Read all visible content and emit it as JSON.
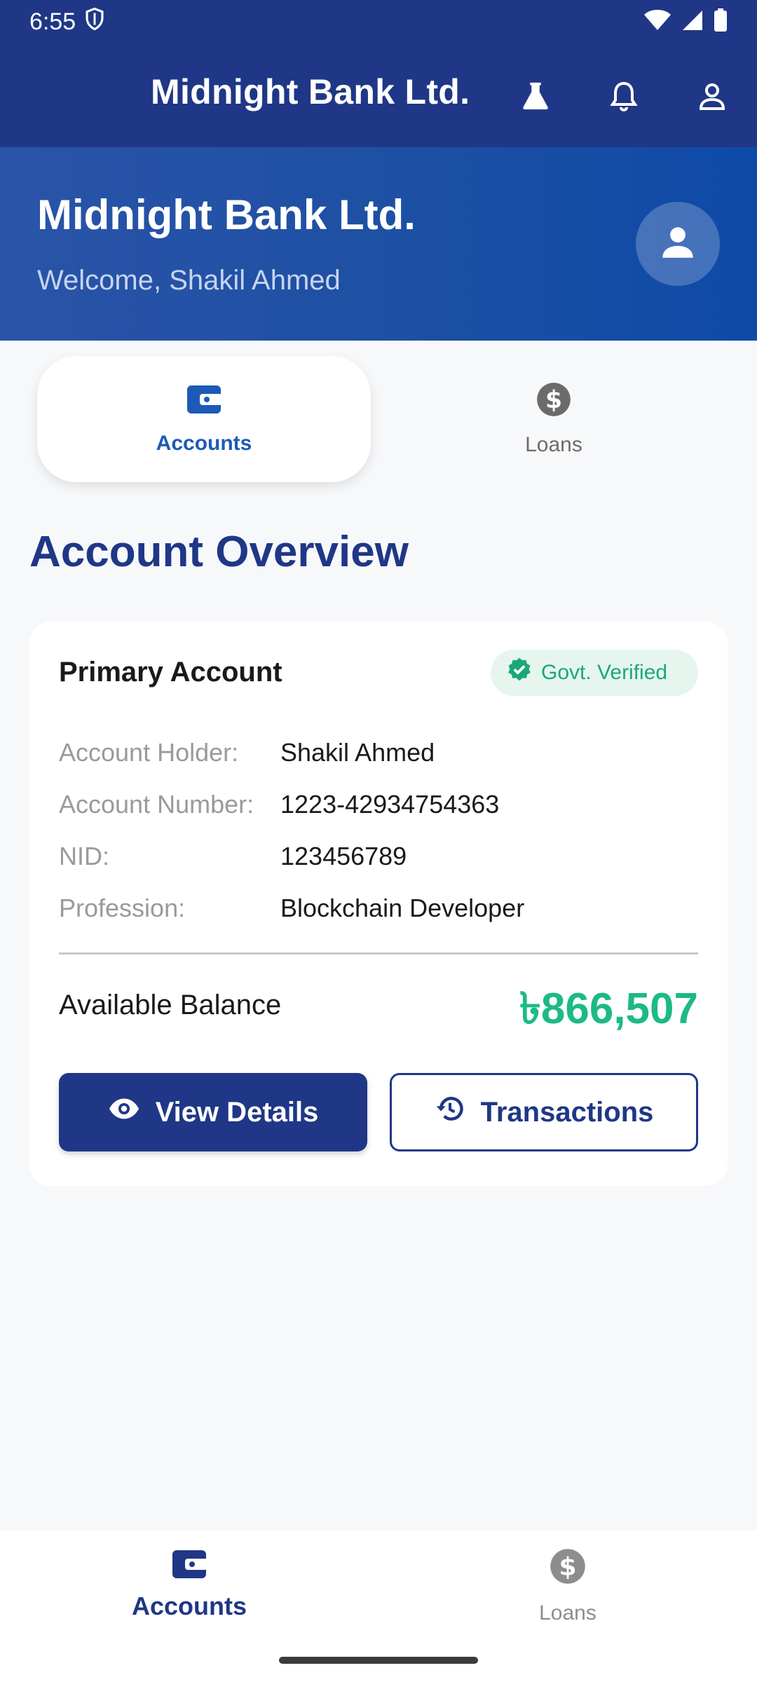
{
  "status_bar": {
    "time": "6:55"
  },
  "app_bar": {
    "title": "Midnight Bank Ltd."
  },
  "banner": {
    "title": "Midnight Bank Ltd.",
    "subtitle": "Welcome, Shakil Ahmed"
  },
  "tabs": [
    {
      "label": "Accounts",
      "icon": "wallet-icon",
      "active": true
    },
    {
      "label": "Loans",
      "icon": "dollar-circle-icon",
      "active": false
    }
  ],
  "section_title": "Account Overview",
  "card": {
    "title": "Primary Account",
    "badge": "Govt. Verified",
    "rows": [
      {
        "label": "Account Holder:",
        "value": "Shakil Ahmed"
      },
      {
        "label": "Account Number:",
        "value": "1223-42934754363"
      },
      {
        "label": "NID:",
        "value": "123456789"
      },
      {
        "label": "Profession:",
        "value": "Blockchain Developer"
      }
    ],
    "balance_label": "Available Balance",
    "balance_value": "৳866,507",
    "view_details_label": "View Details",
    "transactions_label": "Transactions"
  },
  "bottom_nav": [
    {
      "label": "Accounts",
      "icon": "wallet-icon",
      "active": true
    },
    {
      "label": "Loans",
      "icon": "dollar-circle-icon",
      "active": false
    }
  ],
  "colors": {
    "primary": "#1f3786",
    "accent_blue": "#1d5ab6",
    "success": "#1cba84"
  }
}
